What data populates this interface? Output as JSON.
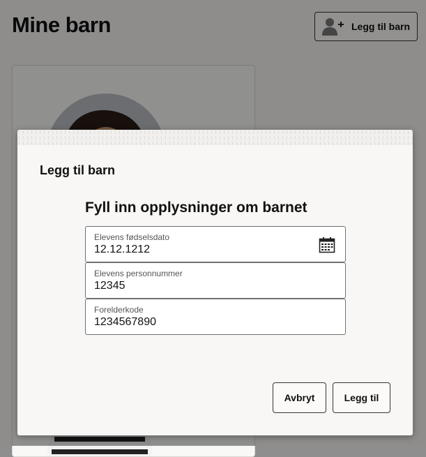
{
  "page": {
    "title": "Mine barn",
    "add_child_button": "Legg til barn",
    "add_child_icon": "add-user-icon"
  },
  "modal": {
    "title": "Legg til barn",
    "heading": "Fyll inn opplysninger om barnet",
    "fields": [
      {
        "label": "Elevens fødselsdato",
        "value": "12.12.1212",
        "icon": "calendar-icon"
      },
      {
        "label": "Elevens personnummer",
        "value": "12345"
      },
      {
        "label": "Forelderkode",
        "value": "1234567890"
      }
    ],
    "cancel_label": "Avbryt",
    "submit_label": "Legg til"
  }
}
